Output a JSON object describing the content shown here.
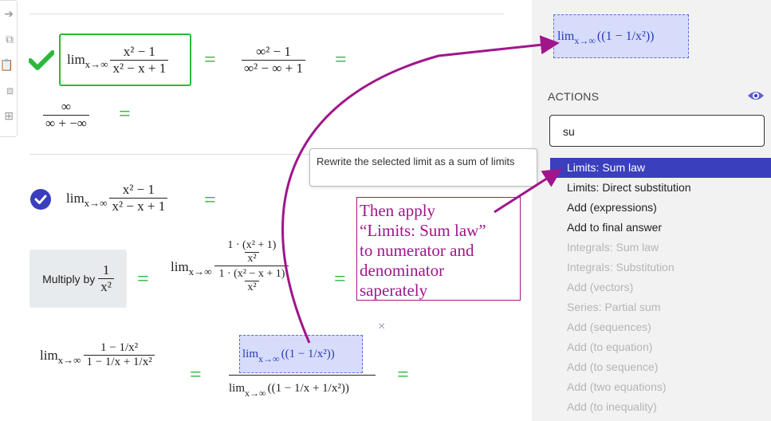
{
  "toolbar": {
    "icons": [
      "arrow-icon",
      "copy-icon",
      "clipboard-icon",
      "duplicate-icon",
      "insert-icon"
    ]
  },
  "steps": {
    "step1": {
      "lim": "lim",
      "sub": "x→∞",
      "num": "x² − 1",
      "den": "x² − x + 1",
      "eq": "=",
      "inf_num": "∞² − 1",
      "inf_den": "∞² − ∞ + 1",
      "eq2": "=",
      "cont_num": "∞",
      "cont_den": "∞ + −∞",
      "eq3": "="
    },
    "step2": {
      "lim": "lim",
      "sub": "x→∞",
      "num": "x² − 1",
      "den": "x² − x + 1",
      "eq": "="
    },
    "multiply": {
      "label": "Multiply by",
      "num": "1",
      "den": "x²",
      "eq": "=",
      "lim": "lim",
      "sub": "x→∞",
      "big_num_top": "1 · (x² + 1)",
      "big_num_bot": "x²",
      "big_den_top": "1 · (x² − x + 1)",
      "big_den_bot": "x²",
      "eq2": "="
    },
    "step3": {
      "lim": "lim",
      "sub": "x→∞",
      "num": "1 − 1/x²",
      "den": "1 − 1/x + 1/x²",
      "eq": "=",
      "sel_lim": "lim",
      "sel_sub": "x→∞",
      "sel_expr": "((1 − 1/x²))",
      "den_lim": "lim",
      "den_sub": "x→∞",
      "den_expr": "((1 − 1/x + 1/x²))",
      "eq2": "=",
      "close": "×"
    }
  },
  "preview": {
    "lim": "lim",
    "sub": "x→∞",
    "expr": "((1 − 1/x²))"
  },
  "actions": {
    "label": "ACTIONS",
    "search_value": "su",
    "items": [
      {
        "label": "Limits: Sum law",
        "state": "selected"
      },
      {
        "label": "Limits: Direct substitution",
        "state": "enabled"
      },
      {
        "label": "Add (expressions)",
        "state": "enabled"
      },
      {
        "label": "Add to final answer",
        "state": "enabled"
      },
      {
        "label": "Integrals: Sum law",
        "state": "disabled"
      },
      {
        "label": "Integrals: Substitution",
        "state": "disabled"
      },
      {
        "label": "Add (vectors)",
        "state": "disabled"
      },
      {
        "label": "Series: Partial sum",
        "state": "disabled"
      },
      {
        "label": "Add (sequences)",
        "state": "disabled"
      },
      {
        "label": "Add (to equation)",
        "state": "disabled"
      },
      {
        "label": "Add (to sequence)",
        "state": "disabled"
      },
      {
        "label": "Add (two equations)",
        "state": "disabled"
      },
      {
        "label": "Add (to inequality)",
        "state": "disabled"
      }
    ]
  },
  "tooltip": "Rewrite the selected limit as a sum of limits",
  "annotation": [
    "Then apply",
    "“Limits: Sum law”",
    "to numerator and",
    "denominator",
    "saperately"
  ],
  "colors": {
    "accent": "#3a3fbd",
    "check": "#2db83d",
    "annotation": "#a0158c",
    "selection": "#d6dcfa"
  }
}
